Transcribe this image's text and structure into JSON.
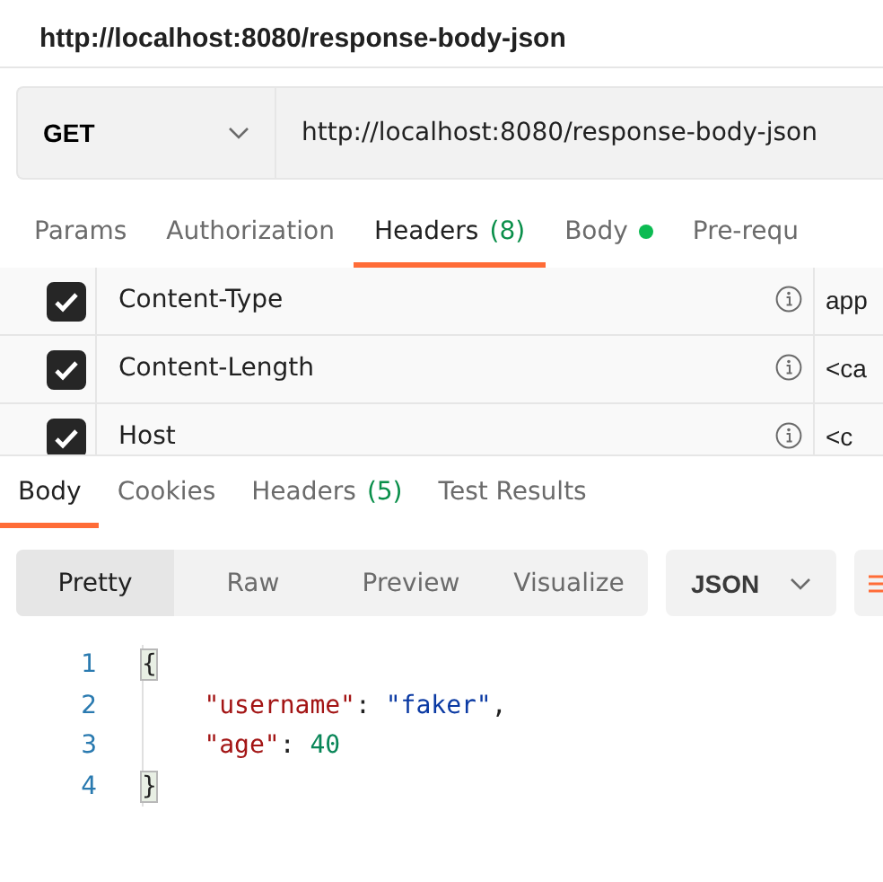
{
  "title": "http://localhost:8080/response-body-json",
  "request": {
    "method": "GET",
    "url": "http://localhost:8080/response-body-json"
  },
  "request_tabs": [
    {
      "label": "Params",
      "selected": false,
      "dot": false
    },
    {
      "label": "Authorization",
      "selected": false,
      "dot": false
    },
    {
      "label": "Headers",
      "count": "(8)",
      "selected": true,
      "dot": false
    },
    {
      "label": "Body",
      "selected": false,
      "dot": true
    },
    {
      "label": "Pre-requ",
      "selected": false,
      "dot": false
    }
  ],
  "headers": [
    {
      "checked": true,
      "key": "Content-Type",
      "value": "app"
    },
    {
      "checked": true,
      "key": "Content-Length",
      "value": "<ca"
    },
    {
      "checked": true,
      "key": "Host",
      "value": "<c"
    }
  ],
  "response_tabs": [
    {
      "label": "Body",
      "selected": true
    },
    {
      "label": "Cookies",
      "selected": false
    },
    {
      "label": "Headers",
      "count": "(5)",
      "selected": false
    },
    {
      "label": "Test Results",
      "selected": false
    }
  ],
  "view_modes": [
    {
      "label": "Pretty",
      "selected": true
    },
    {
      "label": "Raw",
      "selected": false
    },
    {
      "label": "Preview",
      "selected": false
    },
    {
      "label": "Visualize",
      "selected": false
    }
  ],
  "format": "JSON",
  "code": [
    {
      "number": "1",
      "indented": false,
      "tokens": [
        {
          "kind": "bracket",
          "text": "{"
        }
      ]
    },
    {
      "number": "2",
      "indented": true,
      "tokens": [
        {
          "kind": "key",
          "text": "\"username\""
        },
        {
          "kind": "punct",
          "text": ": "
        },
        {
          "kind": "string",
          "text": "\"faker\""
        },
        {
          "kind": "punct",
          "text": ","
        }
      ]
    },
    {
      "number": "3",
      "indented": true,
      "tokens": [
        {
          "kind": "key",
          "text": "\"age\""
        },
        {
          "kind": "punct",
          "text": ": "
        },
        {
          "kind": "number",
          "text": "40"
        }
      ]
    },
    {
      "number": "4",
      "indented": false,
      "tokens": [
        {
          "kind": "bracket",
          "text": "}"
        }
      ]
    }
  ]
}
